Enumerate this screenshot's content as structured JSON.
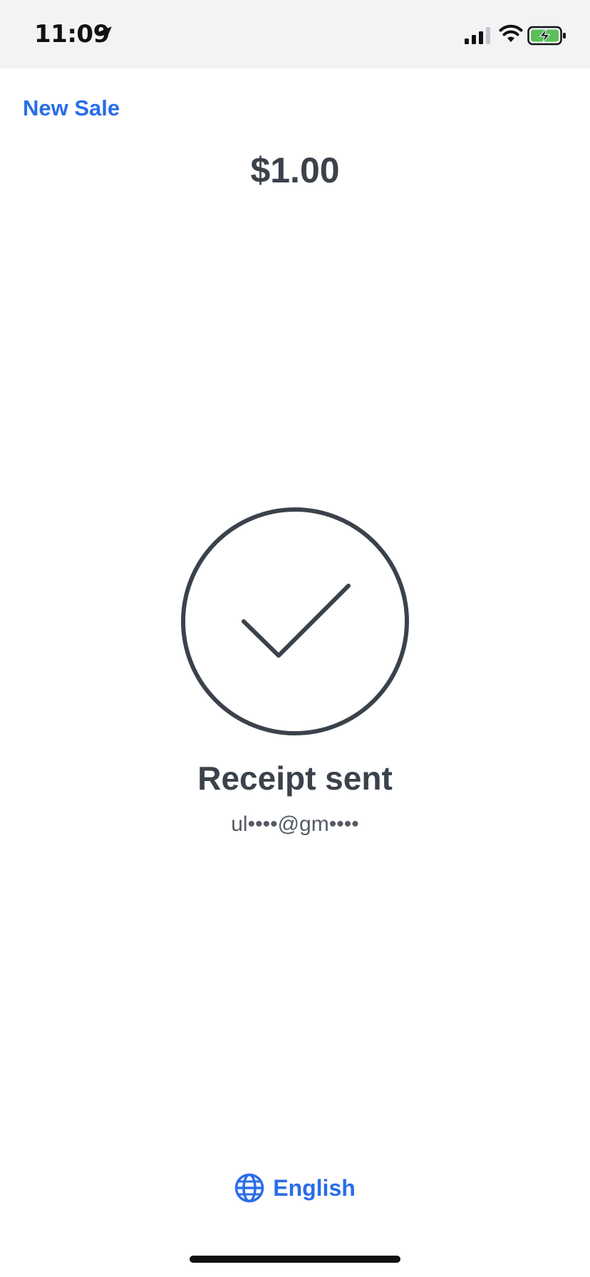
{
  "status_bar": {
    "time": "11:09",
    "location_icon": "location-arrow-icon",
    "signal_icon": "cellular-signal-icon",
    "wifi_icon": "wifi-icon",
    "battery_icon": "battery-charging-icon"
  },
  "header": {
    "new_sale_label": "New Sale",
    "amount": "$1.00"
  },
  "confirmation": {
    "icon": "check-circle-icon",
    "title": "Receipt sent",
    "email": "ul••••@gm••••"
  },
  "footer": {
    "language_icon": "globe-icon",
    "language_label": "English"
  },
  "colors": {
    "accent": "#2a6de8",
    "text_dark": "#3b424b",
    "status_bar_bg": "#f2f3f5",
    "battery_green": "#5ac05a"
  }
}
